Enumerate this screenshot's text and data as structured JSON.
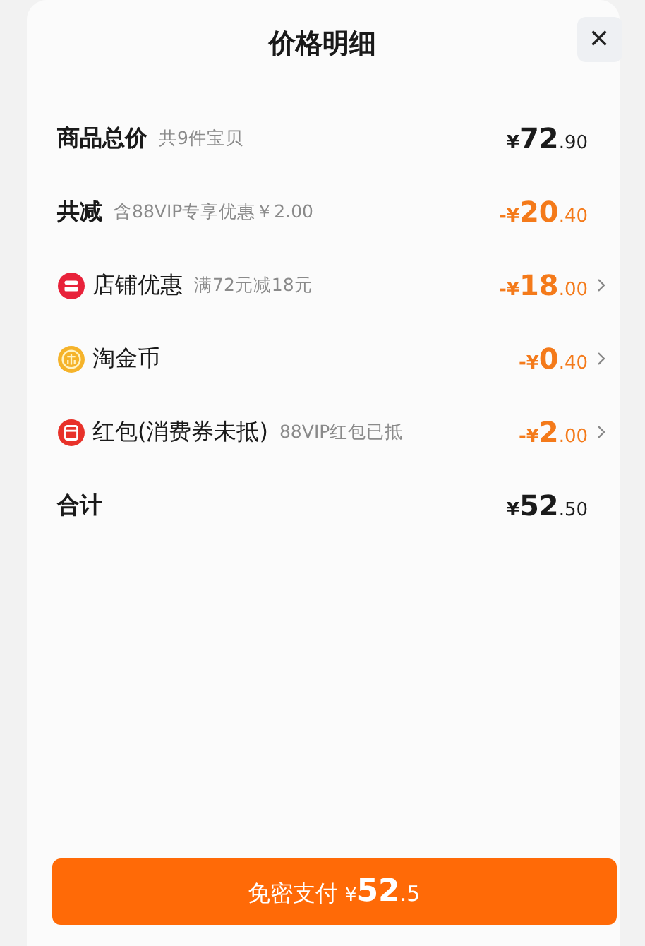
{
  "sheet": {
    "title": "价格明细",
    "close": "×"
  },
  "rows": [
    {
      "kind": "total",
      "label": "商品总价",
      "note": "共9件宝贝",
      "amount": {
        "prefix": "¥",
        "integer": "72",
        "decimal": ".90"
      },
      "expandable": false
    },
    {
      "kind": "reduction",
      "label": "共减",
      "note": "含88VIP专享优惠￥2.00",
      "amount": {
        "prefix": "-¥",
        "integer": "20",
        "decimal": ".40"
      },
      "expandable": false
    },
    {
      "kind": "shop",
      "label": "店铺优惠",
      "note": "满72元减18元",
      "amount": {
        "prefix": "-¥",
        "integer": "18",
        "decimal": ".00"
      },
      "expandable": true
    },
    {
      "kind": "coin",
      "label": "淘金币",
      "amount": {
        "prefix": "-¥",
        "integer": "0",
        "decimal": ".40"
      },
      "expandable": true
    },
    {
      "kind": "packet",
      "label": "红包(消费券未抵)",
      "note": "88VIP红包已抵",
      "amount": {
        "prefix": "-¥",
        "integer": "2",
        "decimal": ".00"
      },
      "expandable": true
    },
    {
      "kind": "total",
      "label": "合计",
      "amount": {
        "prefix": "¥",
        "integer": "52",
        "decimal": ".50"
      },
      "expandable": false
    }
  ],
  "pay_button": {
    "label": "免密支付",
    "prefix": "¥",
    "integer": "52",
    "decimal": ".5"
  }
}
